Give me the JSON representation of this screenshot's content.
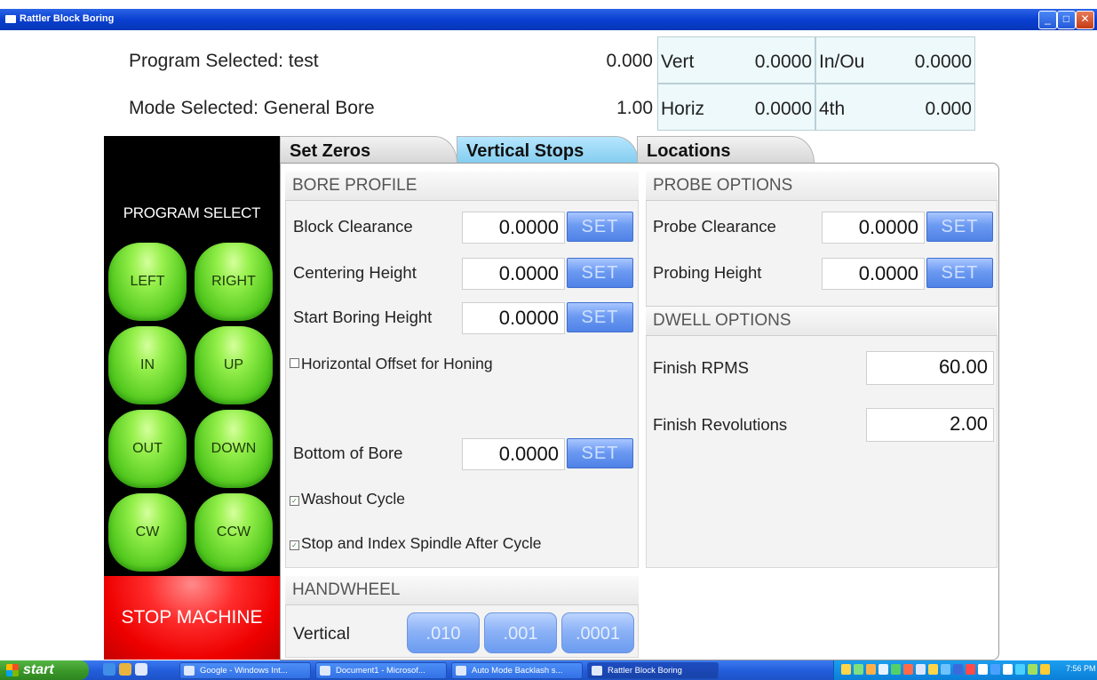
{
  "window": {
    "title": "Rattler Block Boring"
  },
  "header": {
    "program_label": "Program Selected: test",
    "mode_label": "Mode Selected: General Bore",
    "value_1": "0.000",
    "value_2": "1.00",
    "readouts": [
      {
        "label": "Vert",
        "value": "0.0000"
      },
      {
        "label": "In/Ou",
        "value": "0.0000"
      },
      {
        "label": "Horiz",
        "value": "0.0000"
      },
      {
        "label": "4th",
        "value": "0.000"
      }
    ]
  },
  "left_panel": {
    "title": "PROGRAM SELECT",
    "buttons": [
      "LEFT",
      "RIGHT",
      "IN",
      "UP",
      "OUT",
      "DOWN",
      "CW",
      "CCW"
    ],
    "stop_label": "STOP MACHINE"
  },
  "tabs": [
    {
      "label": "Set Zeros",
      "active": false
    },
    {
      "label": "Vertical Stops",
      "active": true
    },
    {
      "label": "Locations",
      "active": false
    }
  ],
  "bore_profile": {
    "title": "BORE PROFILE",
    "fields": [
      {
        "label": "Block Clearance",
        "value": "0.0000"
      },
      {
        "label": "Centering Height",
        "value": "0.0000"
      },
      {
        "label": "Start Boring Height",
        "value": "0.0000"
      },
      {
        "label": "Bottom of Bore",
        "value": "0.0000"
      }
    ],
    "set_label": "SET",
    "checkboxes": [
      {
        "label": "Horizontal Offset for Honing",
        "checked": false
      },
      {
        "label": "Washout Cycle",
        "checked": true
      },
      {
        "label": "Stop and Index Spindle After Cycle",
        "checked": true
      }
    ]
  },
  "probe_options": {
    "title": "PROBE OPTIONS",
    "fields": [
      {
        "label": "Probe Clearance",
        "value": "0.0000"
      },
      {
        "label": "Probing Height",
        "value": "0.0000"
      }
    ]
  },
  "dwell_options": {
    "title": "DWELL OPTIONS",
    "fields": [
      {
        "label": "Finish RPMS",
        "value": "60.00"
      },
      {
        "label": "Finish Revolutions",
        "value": "2.00"
      }
    ]
  },
  "handwheel": {
    "title": "HANDWHEEL",
    "axis_label": "Vertical",
    "increments": [
      ".010",
      ".001",
      ".0001"
    ]
  },
  "taskbar": {
    "start_label": "start",
    "tasks": [
      {
        "label": "Google - Windows Int...",
        "active": false
      },
      {
        "label": "Document1 - Microsof...",
        "active": false
      },
      {
        "label": "Auto Mode Backlash s...",
        "active": false
      },
      {
        "label": "Rattler Block Boring",
        "active": true
      }
    ],
    "clock": "7:56 PM"
  },
  "colors": {
    "titlebar": "#0a3fd0",
    "green_button": "#52c81e",
    "stop_button": "#e00000",
    "active_tab": "#84cdef",
    "set_button": "#6c9af2"
  }
}
